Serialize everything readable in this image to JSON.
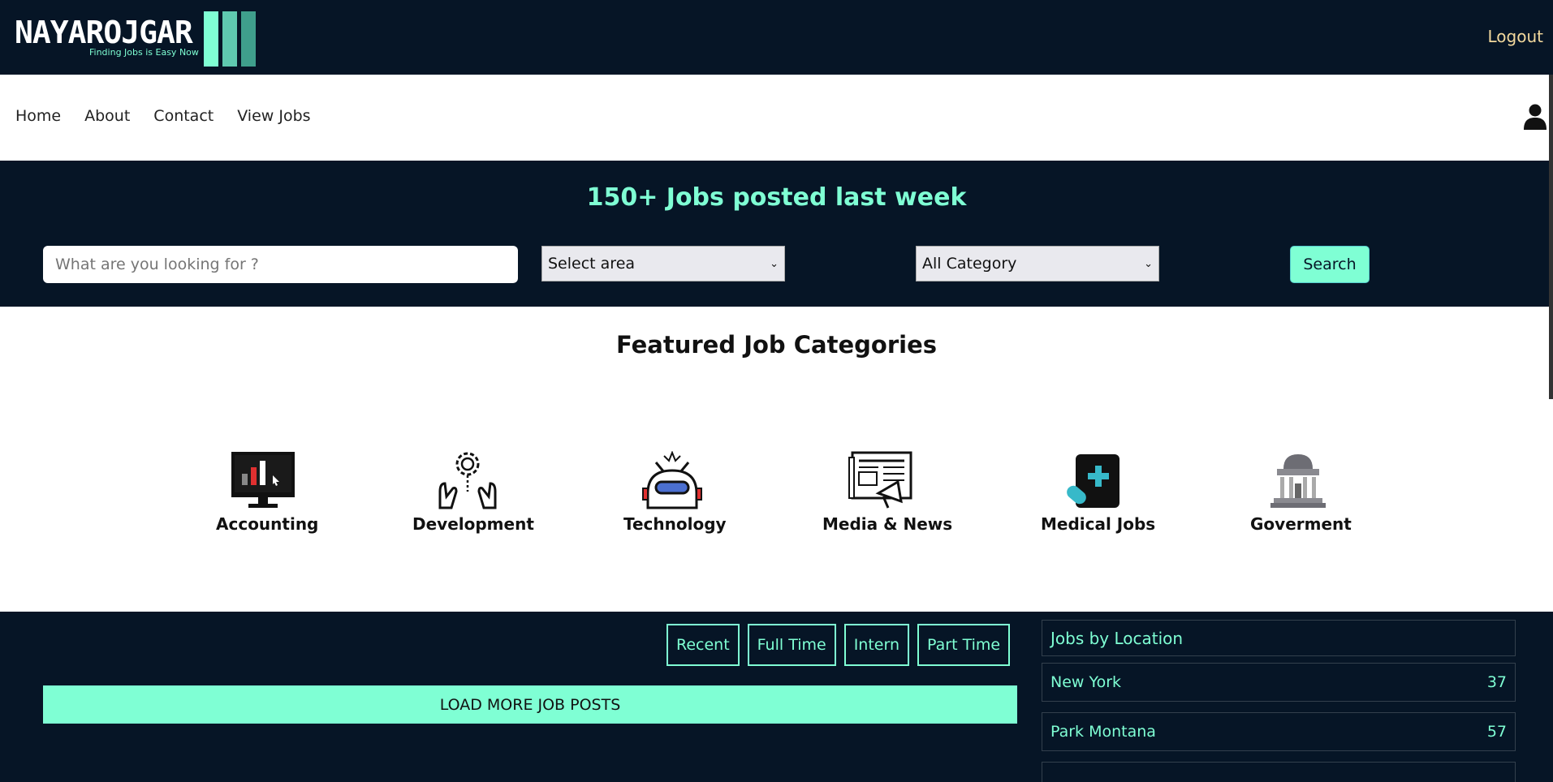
{
  "header": {
    "logo_text": "NAYAROJGAR",
    "tagline": "Finding Jobs is Easy Now",
    "logout_label": "Logout",
    "brand_colors": [
      "#7fffd4",
      "#5fd1b5",
      "#3f9f8c"
    ]
  },
  "nav": {
    "items": [
      {
        "label": "Home"
      },
      {
        "label": "About"
      },
      {
        "label": "Contact"
      },
      {
        "label": "View Jobs"
      }
    ],
    "user_icon": "user-icon"
  },
  "hero": {
    "title": "150+ Jobs posted last week",
    "search_placeholder": "What are you looking for ?",
    "area_select": "Select area",
    "category_select": "All Category",
    "search_label": "Search"
  },
  "featured": {
    "title": "Featured Job Categories",
    "categories": [
      {
        "label": "Accounting",
        "icon": "monitor-chart-icon"
      },
      {
        "label": "Development",
        "icon": "gear-bulb-hands-icon"
      },
      {
        "label": "Technology",
        "icon": "robot-icon"
      },
      {
        "label": "Media & News",
        "icon": "newspaper-megaphone-icon"
      },
      {
        "label": "Medical Jobs",
        "icon": "medical-kit-icon"
      },
      {
        "label": "Goverment",
        "icon": "government-building-icon"
      }
    ]
  },
  "jobs": {
    "filters": [
      "Recent",
      "Full Time",
      "Intern",
      "Part Time"
    ],
    "load_more_label": "LOAD MORE JOB POSTS"
  },
  "locations": {
    "title": "Jobs by Location",
    "items": [
      {
        "name": "New York",
        "count": "37"
      },
      {
        "name": "Park Montana",
        "count": "57"
      }
    ]
  }
}
